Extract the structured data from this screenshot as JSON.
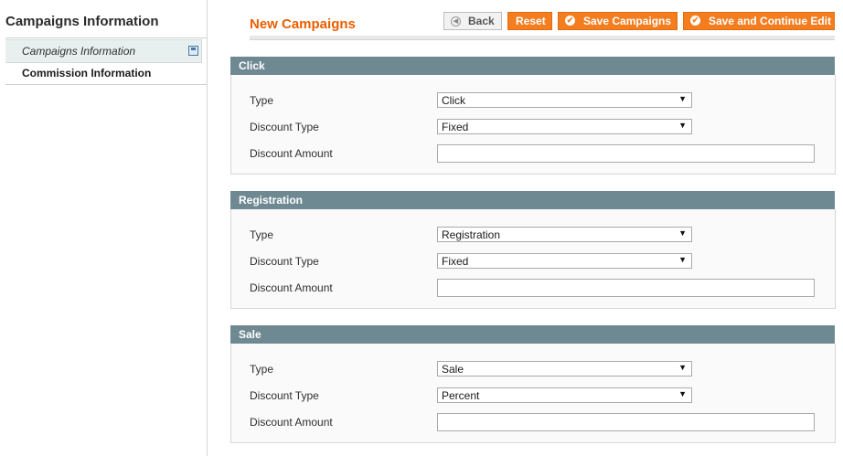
{
  "sidebar": {
    "title": "Campaigns Information",
    "items": [
      {
        "label": "Campaigns Information"
      },
      {
        "label": "Commission Information"
      }
    ]
  },
  "header": {
    "title": "New Campaigns",
    "buttons": {
      "back": "Back",
      "reset": "Reset",
      "save": "Save Campaigns",
      "save_continue": "Save and Continue Edit"
    }
  },
  "sections": [
    {
      "title": "Click",
      "type_label": "Type",
      "type_value": "Click",
      "discount_type_label": "Discount Type",
      "discount_type_value": "Fixed",
      "discount_amount_label": "Discount Amount",
      "discount_amount_value": ""
    },
    {
      "title": "Registration",
      "type_label": "Type",
      "type_value": "Registration",
      "discount_type_label": "Discount Type",
      "discount_type_value": "Fixed",
      "discount_amount_label": "Discount Amount",
      "discount_amount_value": ""
    },
    {
      "title": "Sale",
      "type_label": "Type",
      "type_value": "Sale",
      "discount_type_label": "Discount Type",
      "discount_type_value": "Percent",
      "discount_amount_label": "Discount Amount",
      "discount_amount_value": ""
    }
  ],
  "colors": {
    "accent": "#f47d20",
    "title": "#eb5e00",
    "section_header": "#6f8992"
  }
}
